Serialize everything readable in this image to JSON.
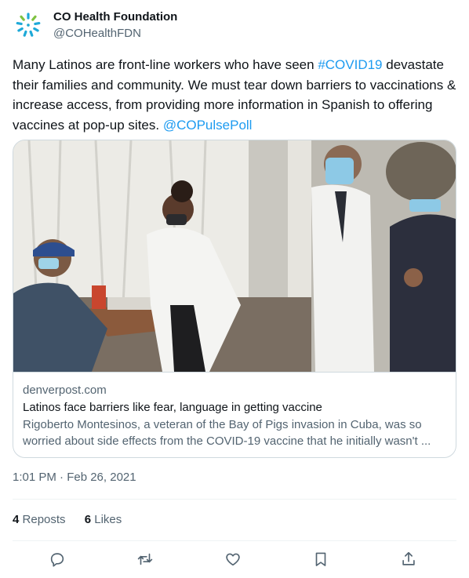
{
  "author": {
    "name": "CO Health Foundation",
    "handle": "@COHealthFDN",
    "avatar_icon": "co-health-foundation-logo",
    "brand_colors": [
      "#1ea9d8",
      "#7fc241"
    ]
  },
  "tweet": {
    "text_before_hashtag": "Many Latinos are front-line workers who have seen ",
    "hashtag": "#COVID19",
    "text_after_hashtag": " devastate their families and community. We must tear down barriers to vaccinations & increase access, from providing more information in Spanish to offering vaccines at pop-up sites. ",
    "mention": "@COPulsePoll",
    "link_color": "#1d9bf0"
  },
  "card": {
    "image_alt": "Masked health workers in white coats attending patients at a vaccination site",
    "domain": "denverpost.com",
    "title": "Latinos face barriers like fear, language in getting vaccine",
    "description": "Rigoberto Montesinos, a veteran of the Bay of Pigs invasion in Cuba, was so worried about side effects from the COVID-19 vaccine that he initially wasn't ..."
  },
  "timestamp": "1:01 PM · Feb 26, 2021",
  "stats": {
    "reposts_count": "4",
    "reposts_label": "Reposts",
    "likes_count": "6",
    "likes_label": "Likes"
  },
  "actions": [
    {
      "icon": "reply-icon"
    },
    {
      "icon": "repost-icon"
    },
    {
      "icon": "like-icon"
    },
    {
      "icon": "bookmark-icon"
    },
    {
      "icon": "share-icon"
    }
  ]
}
